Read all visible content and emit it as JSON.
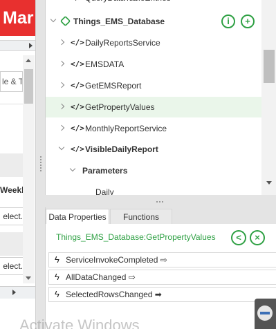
{
  "left_panel": {
    "header_fragment": "Mar",
    "search_fragment": "le & T",
    "weekly_fragment": "Weekly",
    "select_fragment_1": "elect.",
    "select_fragment_2": "elect."
  },
  "tree": {
    "top_partial": "</> QueryDataTableEntries",
    "rows": [
      {
        "label": "Things_EMS_Database",
        "expanded": true,
        "bold": true
      },
      {
        "label": "DailyReportsService",
        "code": "</>"
      },
      {
        "label": "EMSDATA",
        "code": "</>"
      },
      {
        "label": "GetEMSReport",
        "code": "</>"
      },
      {
        "label": "GetPropertyValues",
        "code": "</>",
        "selected": true
      },
      {
        "label": "MonthlyReportService",
        "code": "</>"
      },
      {
        "label": "VisibleDailyReport",
        "code": "</>",
        "expanded": true,
        "bold": true
      },
      {
        "label": "Parameters",
        "expanded": true,
        "bold": true
      },
      {
        "label": "Daily",
        "code": ""
      }
    ],
    "info_icon": "i",
    "add_icon": "+"
  },
  "props": {
    "tabs": [
      "Data Properties",
      "Functions"
    ],
    "active_tab": "Data Properties",
    "service_title": "Things_EMS_Database:GetPropertyValues",
    "events": [
      {
        "label": "ServiceInvokeCompleted",
        "arrow": "⇨"
      },
      {
        "label": "AllDataChanged",
        "arrow": "⇨"
      },
      {
        "label": "SelectedRowsChanged",
        "arrow": "➡"
      }
    ]
  },
  "overlay": {
    "watermark": "Activate Windows"
  },
  "colors": {
    "accent_green": "#2ea043",
    "header_red": "#e8302f",
    "selected_row": "#eaf6ea"
  }
}
